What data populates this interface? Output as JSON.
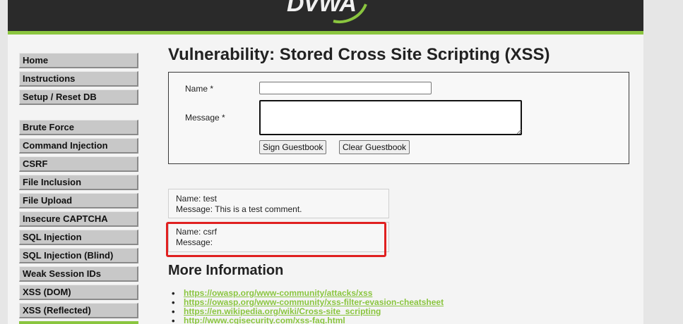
{
  "header": {
    "logo_text": "DVWA"
  },
  "menu": {
    "group1": [
      "Home",
      "Instructions",
      "Setup / Reset DB"
    ],
    "group2": [
      "Brute Force",
      "Command Injection",
      "CSRF",
      "File Inclusion",
      "File Upload",
      "Insecure CAPTCHA",
      "SQL Injection",
      "SQL Injection (Blind)",
      "Weak Session IDs",
      "XSS (DOM)",
      "XSS (Reflected)"
    ]
  },
  "page": {
    "title": "Vulnerability: Stored Cross Site Scripting (XSS)",
    "form": {
      "name_label": "Name *",
      "message_label": "Message *",
      "name_value": "",
      "message_value": "",
      "sign_button": "Sign Guestbook",
      "clear_button": "Clear Guestbook"
    },
    "entries": [
      {
        "name_line": "Name: test",
        "message_line": "Message: This is a test comment."
      },
      {
        "name_line": "Name: csrf",
        "message_line": "Message:"
      }
    ],
    "more_info_heading": "More Information",
    "links": [
      "https://owasp.org/www-community/attacks/xss",
      "https://owasp.org/www-community/xss-filter-evasion-cheatsheet",
      "https://en.wikipedia.org/wiki/Cross-site_scripting",
      "http://www.cgisecurity.com/xss-faq.html"
    ]
  },
  "colors": {
    "accent": "#8ac53f",
    "header_bg": "#2a2a2a",
    "highlight": "#e02020"
  }
}
